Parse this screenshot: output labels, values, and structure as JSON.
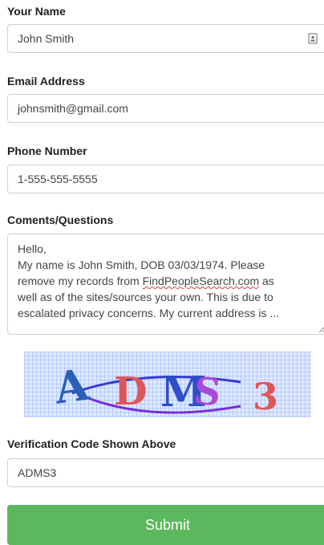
{
  "form": {
    "name": {
      "label": "Your Name",
      "value": "John Smith"
    },
    "email": {
      "label": "Email Address",
      "value": "johnsmith@gmail.com"
    },
    "phone": {
      "label": "Phone Number",
      "value": "1-555-555-5555"
    },
    "comments": {
      "label": "Coments/Questions",
      "lines": [
        "Hello,",
        "My name is John Smith, DOB 03/03/1974. Please",
        "remove my records from",
        "FindPeopleSearch.com",
        "as",
        "well as of the sites/sources your own. This is due to",
        "escalated privacy concerns. My current address is ..."
      ]
    },
    "captcha": {
      "text": "ADMS3",
      "chars": [
        "A",
        "D",
        "M",
        "S",
        "3"
      ]
    },
    "verification": {
      "label": "Verification Code Shown Above",
      "value": "ADMS3"
    },
    "submit_label": "Submit"
  },
  "colors": {
    "submit_bg": "#5cb85c",
    "captcha_grid": "#7fa6ff"
  },
  "icons": {
    "name_field": "contact-card-icon",
    "textarea": "resize-grip-icon"
  }
}
